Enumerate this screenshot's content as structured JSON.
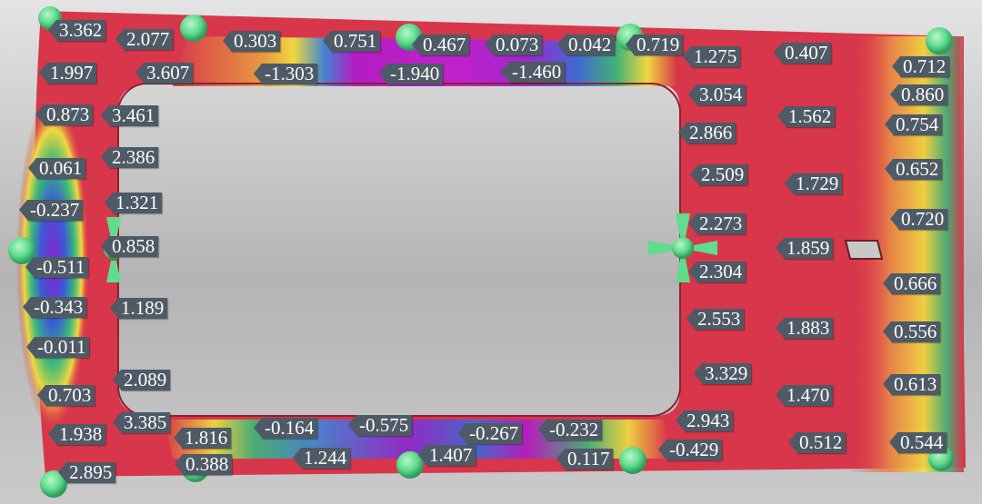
{
  "measurement_labels": [
    "3.362",
    "2.077",
    "0.303",
    "0.751",
    "0.467",
    "0.073",
    "0.042",
    "0.719",
    "1.275",
    "0.407",
    "0.712",
    "1.997",
    "3.607",
    "-1.303",
    "-1.940",
    "-1.460",
    "0.860",
    "0.873",
    "3.461",
    "3.054",
    "1.562",
    "0.754",
    "2.866",
    "0.061",
    "2.386",
    "0.652",
    "2.509",
    "1.729",
    "-0.237",
    "1.321",
    "0.720",
    "2.273",
    "0.858",
    "1.859",
    "-0.511",
    "2.304",
    "0.666",
    "-0.343",
    "1.189",
    "2.553",
    "1.883",
    "0.556",
    "-0.011",
    "2.089",
    "3.329",
    "0.613",
    "0.703",
    "1.470",
    "3.385",
    "2.943",
    "1.938",
    "-0.164",
    "-0.575",
    "-0.267",
    "-0.232",
    "1.816",
    "0.512",
    "0.544",
    "-0.429",
    "1.244",
    "1.407",
    "2.895",
    "0.388",
    "0.117"
  ],
  "colors": {
    "nominal": "#d8364a",
    "high": "#c8284e",
    "mid": "#f5e23a",
    "low": "#2fa86e",
    "deep_low": "#3a4fd8",
    "very_low": "#b61cc8",
    "label_bg": "#4e5a66",
    "support_marker": "#5fdc8c"
  },
  "markers": [
    "support-pin",
    "clamp-marker"
  ]
}
